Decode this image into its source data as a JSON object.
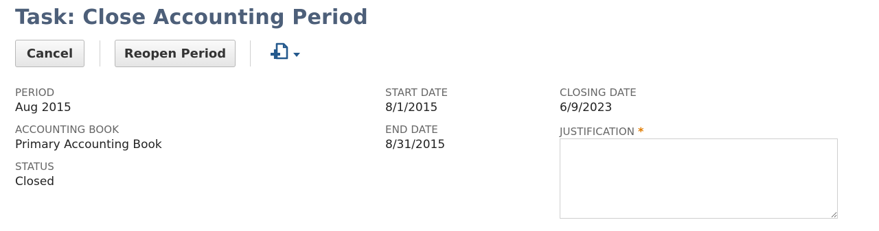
{
  "page": {
    "title": "Task: Close Accounting Period"
  },
  "toolbar": {
    "cancel_label": "Cancel",
    "reopen_label": "Reopen Period",
    "actions_icon": "add-document-icon",
    "actions_menu_icon": "chevron-down-icon"
  },
  "fields": {
    "period": {
      "label": "PERIOD",
      "value": "Aug 2015"
    },
    "accounting_book": {
      "label": "ACCOUNTING BOOK",
      "value": "Primary Accounting Book"
    },
    "status": {
      "label": "STATUS",
      "value": "Closed"
    },
    "start_date": {
      "label": "START DATE",
      "value": "8/1/2015"
    },
    "end_date": {
      "label": "END DATE",
      "value": "8/31/2015"
    },
    "closing_date": {
      "label": "CLOSING DATE",
      "value": "6/9/2023"
    },
    "justification": {
      "label": "JUSTIFICATION",
      "required_mark": "*",
      "value": ""
    }
  },
  "colors": {
    "title": "#4d5f79",
    "icon": "#24598d",
    "required": "#e07b00"
  }
}
